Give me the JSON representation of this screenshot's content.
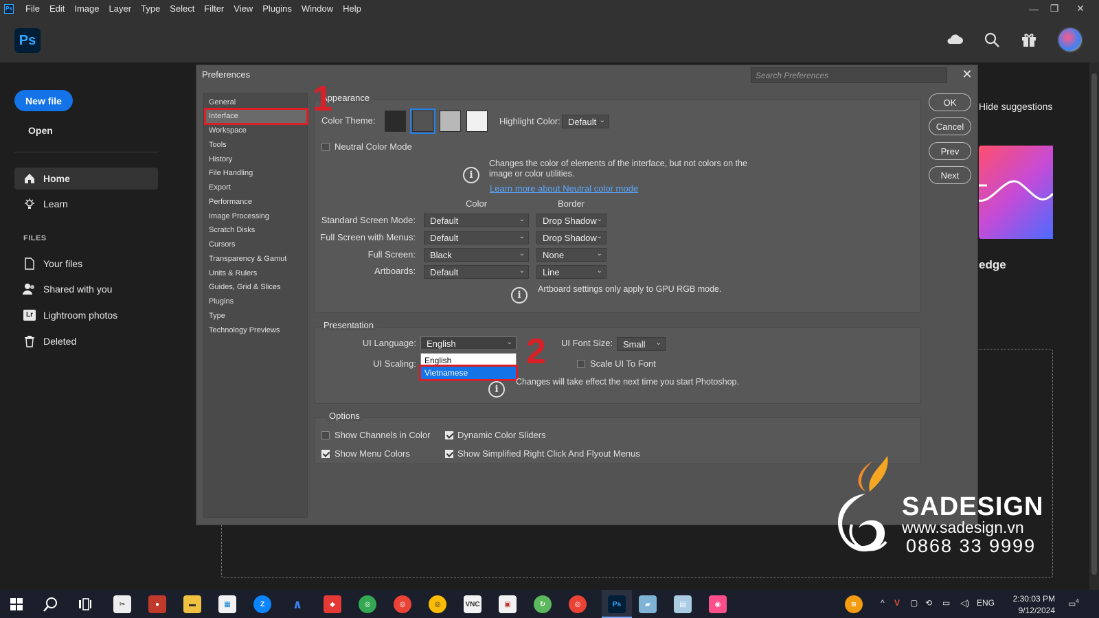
{
  "menubar": {
    "items": [
      "File",
      "Edit",
      "Image",
      "Layer",
      "Type",
      "Select",
      "Filter",
      "View",
      "Plugins",
      "Window",
      "Help"
    ]
  },
  "app": {
    "logo": "Ps",
    "new_file": "New file",
    "open": "Open",
    "nav": [
      {
        "label": "Home",
        "icon": "home-icon"
      },
      {
        "label": "Learn",
        "icon": "lightbulb-icon"
      }
    ],
    "files_heading": "FILES",
    "files": [
      {
        "label": "Your files",
        "icon": "file-icon"
      },
      {
        "label": "Shared with you",
        "icon": "people-icon"
      },
      {
        "label": "Lightroom photos",
        "icon": "lightroom-icon"
      },
      {
        "label": "Deleted",
        "icon": "trash-icon"
      }
    ],
    "hide_suggestions": "Hide suggestions",
    "suggestion_caption": "edge"
  },
  "dialog": {
    "title": "Preferences",
    "search_placeholder": "Search Preferences",
    "categories": [
      "General",
      "Interface",
      "Workspace",
      "Tools",
      "History",
      "File Handling",
      "Export",
      "Performance",
      "Image Processing",
      "Scratch Disks",
      "Cursors",
      "Transparency & Gamut",
      "Units & Rulers",
      "Guides, Grid & Slices",
      "Plugins",
      "Type",
      "Technology Previews"
    ],
    "selected_category": "Interface",
    "step_markers": [
      "1",
      "2"
    ],
    "buttons": {
      "ok": "OK",
      "cancel": "Cancel",
      "prev": "Prev",
      "next": "Next"
    },
    "appearance": {
      "title": "Appearance",
      "color_theme_label": "Color Theme:",
      "swatch_colors": [
        "#2b2b2b",
        "#535353",
        "#b8b8b8",
        "#f0f0f0"
      ],
      "highlight_label": "Highlight Color:",
      "highlight_value": "Default",
      "neutral_label": "Neutral Color Mode",
      "neutral_info": "Changes the color of elements of the interface, but not colors on the image or color utilities.",
      "neutral_link": "Learn more about Neutral color mode",
      "col_color": "Color",
      "col_border": "Border",
      "rows": [
        {
          "label": "Standard Screen Mode:",
          "color": "Default",
          "border": "Drop Shadow"
        },
        {
          "label": "Full Screen with Menus:",
          "color": "Default",
          "border": "Drop Shadow"
        },
        {
          "label": "Full Screen:",
          "color": "Black",
          "border": "None"
        },
        {
          "label": "Artboards:",
          "color": "Default",
          "border": "Line"
        }
      ],
      "artboard_info": "Artboard settings only apply to GPU RGB mode."
    },
    "presentation": {
      "title": "Presentation",
      "ui_language_label": "UI Language:",
      "ui_language_value": "English",
      "language_options": [
        "English",
        "Vietnamese"
      ],
      "highlighted_option": "Vietnamese",
      "ui_scaling_label": "UI Scaling:",
      "ui_font_size_label": "UI Font Size:",
      "ui_font_size_value": "Small",
      "scale_ui_label": "Scale UI To Font",
      "restart_info": "Changes will take effect the next time you start Photoshop."
    },
    "options": {
      "title": "Options",
      "show_channels": "Show Channels in Color",
      "dynamic_sliders": "Dynamic Color Sliders",
      "show_menu_colors": "Show Menu Colors",
      "simplified_menus": "Show Simplified Right Click And Flyout Menus"
    }
  },
  "watermark": {
    "name": "SADESIGN",
    "url": "www.sadesign.vn",
    "phone": "0868 33 9999"
  },
  "taskbar": {
    "language": "ENG",
    "time": "2:30:03 PM",
    "date": "9/12/2024",
    "notification_count": "4"
  },
  "colors": {
    "accent": "#1473e6",
    "annotation_red": "#d92027",
    "link": "#5aa7ff"
  }
}
